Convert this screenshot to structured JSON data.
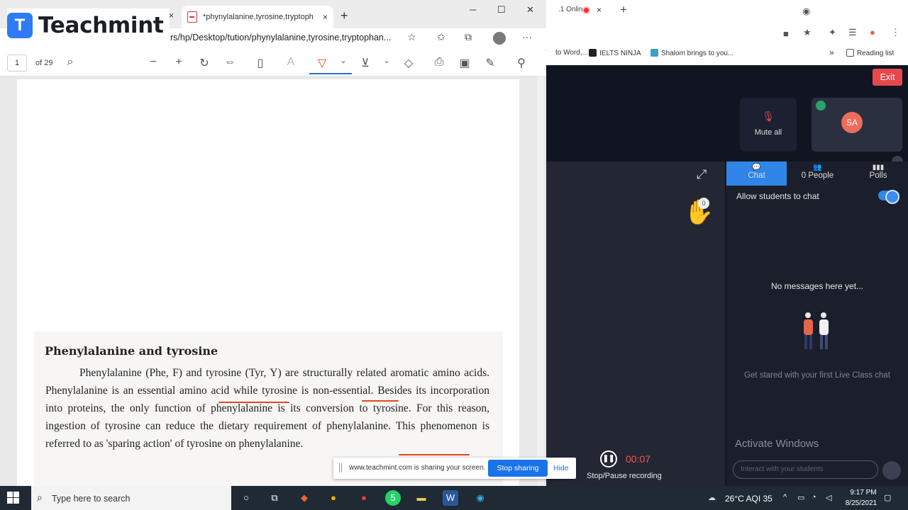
{
  "logo": {
    "text": "Teachmint",
    "mark": "T"
  },
  "edge": {
    "tab_title": "*phynylalanine,tyrosine,tryptoph",
    "tab_close": "×",
    "left_tab_close": "×",
    "new_tab": "+",
    "window_controls": [
      "─",
      "☐",
      "✕"
    ],
    "url": "rs/hp/Desktop/tution/phynylalanine,tyrosine,tryptophan...",
    "more": "···"
  },
  "pdf": {
    "page_current": "1",
    "page_total": "of 29",
    "heading": "Phenylalanine and tyrosine",
    "paragraph": "Phenylalanine (Phe, F) and tyrosine (Tyr, Y) are structurally related aromatic amino acids. Phenylalanine is an essential amino acid while tyrosine is non-essential. Besides its incorporation into proteins, the only function of phenylalanine is its conversion to tyrosine. For this reason, ingestion of tyrosine can reduce the dietary requirement of phenylalanine. This phenomenon is referred to as 'sparing action' of tyrosine on phenylalanine.",
    "annotation_color": "#e24a1b"
  },
  "chrome": {
    "tab_text": ".1 Online",
    "tab_close": "×",
    "new_tab": "+",
    "bookmarks": [
      {
        "label": "to Word,...",
        "color": "#ffffff"
      },
      {
        "label": "IELTS NINJA",
        "color": "#222222"
      },
      {
        "label": "Shalom brings to you...",
        "color": "#3aa0c8"
      }
    ],
    "bookmarks_more": "»",
    "reading_list": "Reading list"
  },
  "classroom": {
    "exit_label": "Exit",
    "mute_all_label": "Mute all",
    "avatar_initials": "SA",
    "hand_count": "0",
    "tabs": [
      {
        "label": "Chat",
        "icon": "chat-icon"
      },
      {
        "label": "0 People",
        "icon": "people-icon"
      },
      {
        "label": "Polls",
        "icon": "polls-icon"
      }
    ],
    "allow_chat_label": "Allow students to chat",
    "allow_chat_on": true,
    "no_messages": "No messages here yet...",
    "get_started": "Get stared with your first Live Class chat",
    "activate_windows": "Activate Windows",
    "chat_placeholder": "Interact with your students",
    "recording_time": "00:07",
    "recording_label": "Stop/Pause recording",
    "accent": "#2f85e8",
    "danger": "#e5484d"
  },
  "share_bar": {
    "text": "www.teachmint.com is sharing your screen.",
    "stop_label": "Stop sharing",
    "hide_label": "Hide"
  },
  "taskbar": {
    "search_placeholder": "Type here to search",
    "weather": "26°C  AQI 35",
    "time": "9:17 PM",
    "date": "8/25/2021",
    "badge": "5"
  }
}
